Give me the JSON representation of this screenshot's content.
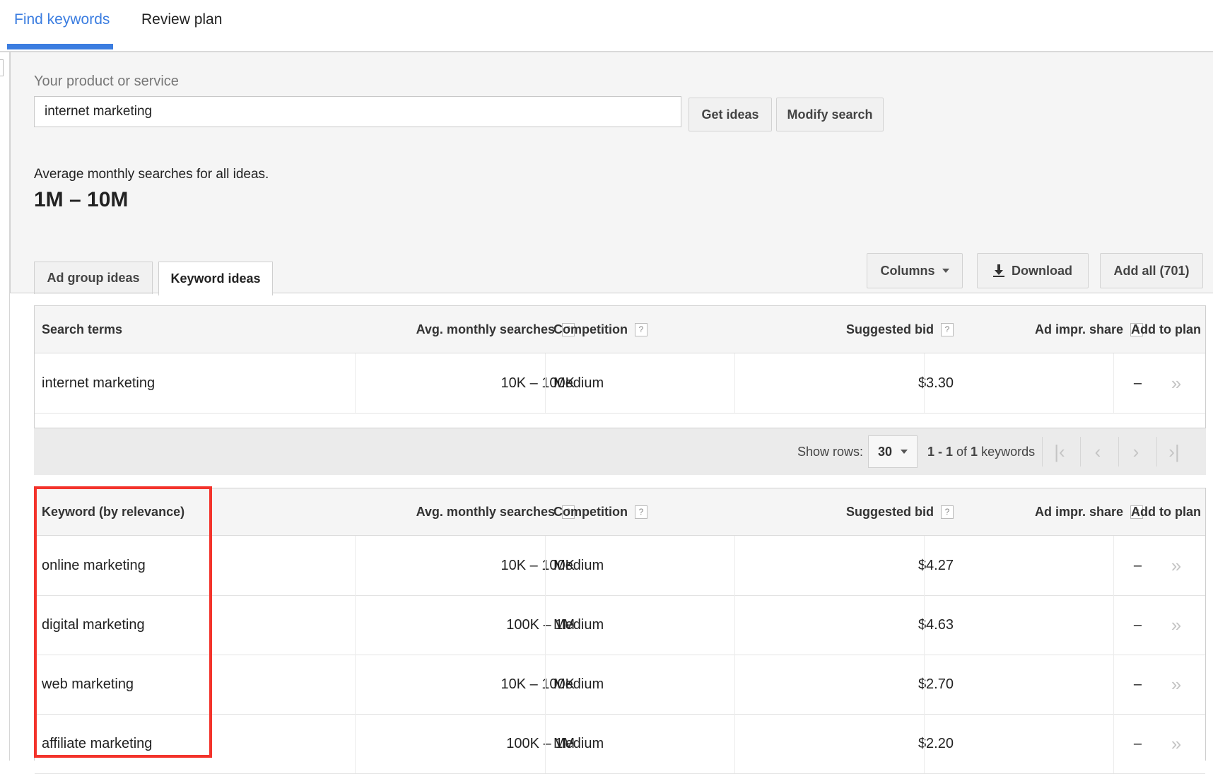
{
  "nav": {
    "tabs": [
      "Find keywords",
      "Review plan"
    ],
    "active_index": 0
  },
  "search": {
    "label": "Your product or service",
    "value": "internet marketing",
    "get_ideas_label": "Get ideas",
    "modify_search_label": "Modify search"
  },
  "summary": {
    "label": "Average monthly searches for all ideas.",
    "value": "1M – 10M"
  },
  "subtabs": {
    "ad_group": "Ad group ideas",
    "keyword": "Keyword ideas",
    "active": "keyword"
  },
  "toolbar": {
    "columns_label": "Columns",
    "download_label": "Download",
    "add_all_label": "Add all (701)"
  },
  "search_terms_table": {
    "headers": {
      "term": "Search terms",
      "avg": "Avg. monthly searches",
      "competition": "Competition",
      "bid": "Suggested bid",
      "impr": "Ad impr. share",
      "add": "Add to plan"
    },
    "help_glyph": "?",
    "rows": [
      {
        "term": "internet marketing",
        "avg": "10K – 100K",
        "competition": "Medium",
        "bid": "$3.30",
        "impr": "–",
        "add": "»"
      }
    ]
  },
  "pagination": {
    "show_rows_label": "Show rows:",
    "rows_value": "30",
    "range_text_start": "1 - 1",
    "range_text_of": "of",
    "range_text_total": "1",
    "range_text_unit": "keywords",
    "first": "|‹",
    "prev": "‹",
    "next": "›",
    "last": "›|"
  },
  "keyword_table": {
    "headers": {
      "term": "Keyword (by relevance)",
      "avg": "Avg. monthly searches",
      "competition": "Competition",
      "bid": "Suggested bid",
      "impr": "Ad impr. share",
      "add": "Add to plan"
    },
    "rows": [
      {
        "term": "online marketing",
        "avg": "10K – 100K",
        "competition": "Medium",
        "bid": "$4.27",
        "impr": "–",
        "add": "»"
      },
      {
        "term": "digital marketing",
        "avg": "100K – 1M",
        "competition": "Medium",
        "bid": "$4.63",
        "impr": "–",
        "add": "»"
      },
      {
        "term": "web marketing",
        "avg": "10K – 100K",
        "competition": "Medium",
        "bid": "$2.70",
        "impr": "–",
        "add": "»"
      },
      {
        "term": "affiliate marketing",
        "avg": "100K – 1M",
        "competition": "Medium",
        "bid": "$2.20",
        "impr": "–",
        "add": "»"
      }
    ]
  },
  "colors": {
    "accent": "#3b7de0",
    "highlight": "#f3332b"
  }
}
